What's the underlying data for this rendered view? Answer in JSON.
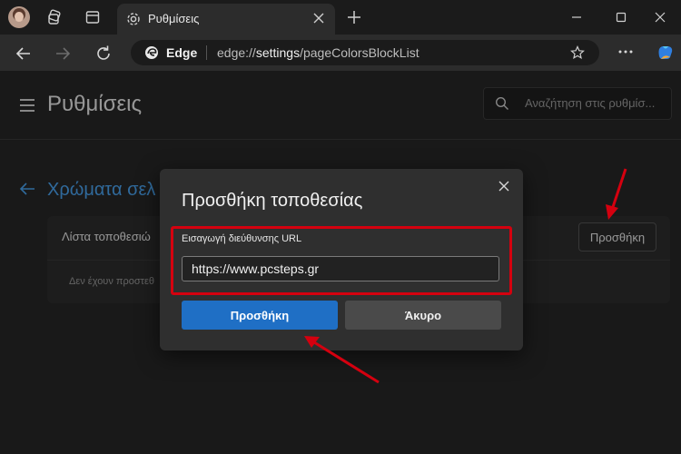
{
  "browser": {
    "tab_title": "Ρυθμίσεις",
    "omnibox_brand": "Edge",
    "url_prefix": "edge://",
    "url_host": "settings",
    "url_path": "/pageColorsBlockList"
  },
  "settings": {
    "page_title": "Ρυθμίσεις",
    "search_placeholder": "Αναζήτηση στις ρυθμίσ...",
    "section_title": "Χρώματα σελ",
    "list_label": "Λίστα τοποθεσιώ",
    "empty_text": "Δεν έχουν προστεθ",
    "add_button": "Προσθήκη"
  },
  "dialog": {
    "title": "Προσθήκη τοποθεσίας",
    "field_label": "Εισαγωγή διεύθυνσης URL",
    "field_value": "https://www.pcsteps.gr",
    "confirm_button": "Προσθήκη",
    "cancel_button": "Άκυρο"
  },
  "colors": {
    "accent": "#1f6fc5",
    "link": "#4aa3f0",
    "annotation": "#d4000f"
  }
}
